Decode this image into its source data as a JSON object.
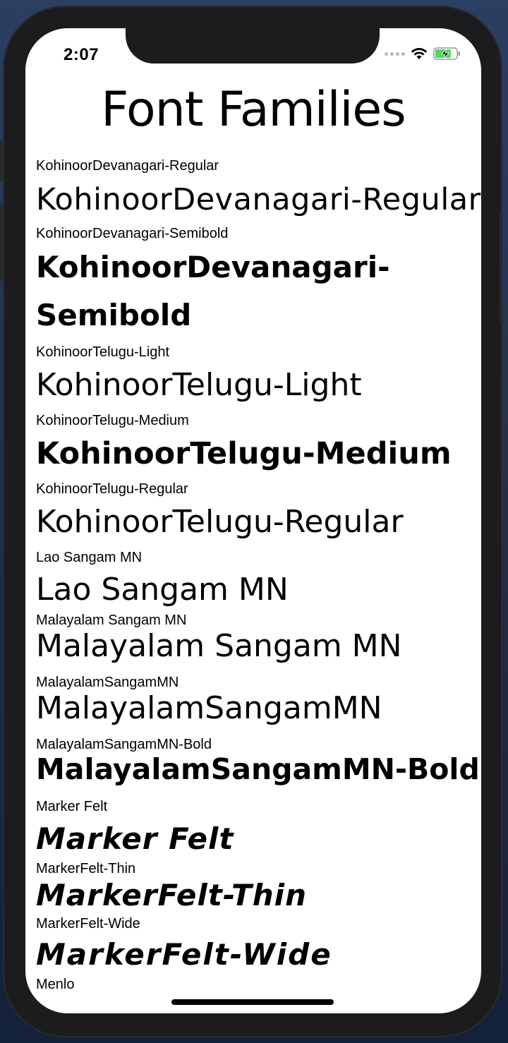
{
  "status_bar": {
    "time": "2:07"
  },
  "header": {
    "title": "Font Families"
  },
  "font_rows": [
    {
      "label": "KohinoorDevanagari-Regular",
      "sample": "KohinoorDevanagari-Regular"
    },
    {
      "label": "KohinoorDevanagari-Semibold",
      "sample_line1": "KohinoorDevanagari-",
      "sample_line2": "Semibold"
    },
    {
      "label": "KohinoorTelugu-Light",
      "sample": "KohinoorTelugu-Light"
    },
    {
      "label": "KohinoorTelugu-Medium",
      "sample": "KohinoorTelugu-Medium"
    },
    {
      "label": "KohinoorTelugu-Regular",
      "sample": "KohinoorTelugu-Regular"
    },
    {
      "label": "Lao Sangam MN",
      "sample": "Lao Sangam MN"
    },
    {
      "label": "Malayalam Sangam MN",
      "sample": "Malayalam Sangam MN"
    },
    {
      "label": "MalayalamSangamMN",
      "sample": "MalayalamSangamMN"
    },
    {
      "label": "MalayalamSangamMN-Bold",
      "sample": "MalayalamSangamMN-Bold"
    },
    {
      "label": "Marker Felt",
      "sample": "Marker Felt"
    },
    {
      "label": "MarkerFelt-Thin",
      "sample": "MarkerFelt-Thin"
    },
    {
      "label": "MarkerFelt-Wide",
      "sample": "MarkerFelt-Wide"
    },
    {
      "label": "Menlo"
    }
  ],
  "icons": {
    "signal": "cellular-signal-icon",
    "wifi": "wifi-icon",
    "battery": "battery-charging-icon"
  },
  "colors": {
    "battery_fill": "#4cd964"
  }
}
